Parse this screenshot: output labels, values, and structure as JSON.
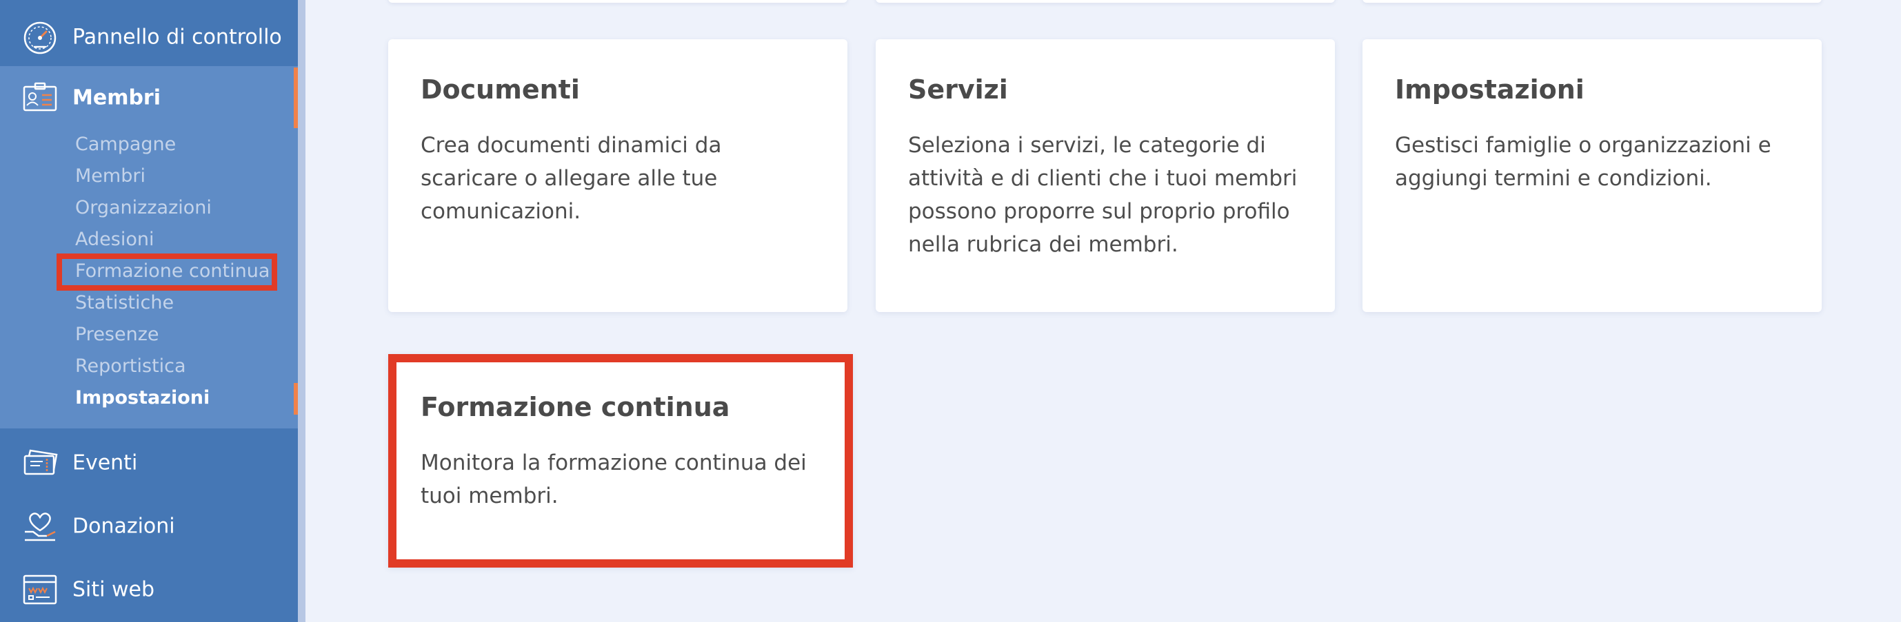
{
  "sidebar": {
    "dashboard": {
      "label": "Pannello di controllo",
      "icon": "speedometer-icon"
    },
    "members": {
      "label": "Membri",
      "icon": "id-card-icon",
      "submenu": [
        {
          "label": "Campagne"
        },
        {
          "label": "Membri"
        },
        {
          "label": "Organizzazioni"
        },
        {
          "label": "Adesioni"
        },
        {
          "label": "Formazione continua"
        },
        {
          "label": "Statistiche"
        },
        {
          "label": "Presenze"
        },
        {
          "label": "Reportistica"
        },
        {
          "label": "Impostazioni",
          "active": true
        }
      ]
    },
    "events": {
      "label": "Eventi",
      "icon": "tickets-icon"
    },
    "donations": {
      "label": "Donazioni",
      "icon": "heart-hand-icon"
    },
    "websites": {
      "label": "Siti web",
      "icon": "browser-window-icon"
    }
  },
  "cards": [
    {
      "title": "Documenti",
      "description": "Crea documenti dinamici da scaricare o allegare alle tue comunicazioni."
    },
    {
      "title": "Servizi",
      "description": "Seleziona i servizi, le categorie di attività e di clienti che i tuoi membri possono proporre sul proprio profilo nella rubrica dei membri."
    },
    {
      "title": "Impostazioni",
      "description": "Gestisci famiglie o organizzazioni e aggiungi termini e condizioni."
    },
    {
      "title": "Formazione continua",
      "description": "Monitora la formazione continua dei tuoi membri."
    }
  ],
  "colors": {
    "sidebar": "#4577b5",
    "sidebar_section": "#5f8cc6",
    "accent": "#f0824a",
    "highlight": "#e13b26",
    "background": "#eef2fb"
  }
}
